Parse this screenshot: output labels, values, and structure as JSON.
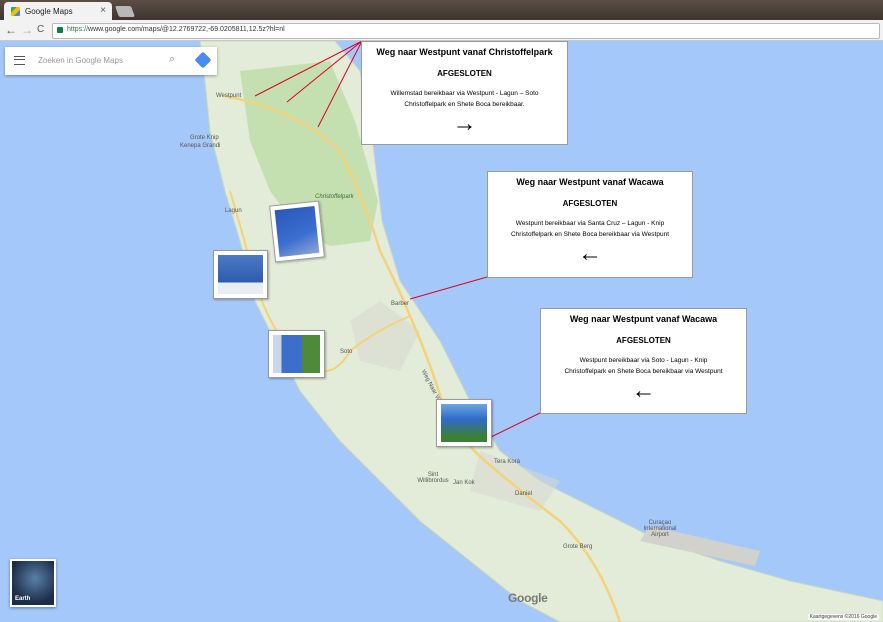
{
  "browser": {
    "tab_title": "Google Maps",
    "tab_close": "×",
    "back": "←",
    "forward": "→",
    "reload": "C",
    "url_scheme": "https://",
    "url_rest": "www.google.com/maps/@12.2769722,-69.0205811,12.5z?hl=nl"
  },
  "search": {
    "placeholder": "Zoeken in Google Maps",
    "search_icon": "search-icon",
    "directions_icon": "directions-icon"
  },
  "places": {
    "westpunt": "Westpunt",
    "grote_knip": "Grote Knip",
    "kenepa": "Kenepa Grandi",
    "christoffelpark": "Christoffelpark",
    "lagun": "Lagun",
    "barber": "Barber",
    "soto": "Soto",
    "weg_naar_westpunt": "Weg Naar Westpunt",
    "tera_kora": "Tera Korá",
    "sint_willibrordus": "Sint Willibrordus",
    "jan_kok": "Jan Kok",
    "daniel": "Daniel",
    "curacao_airport": "Curaçao International Airport",
    "grote_berg": "Grote Berg"
  },
  "callouts": [
    {
      "title": "Weg naar Westpunt vanaf Christoffelpark",
      "status": "AFGESLOTEN",
      "line1": "Willemstad bereikbaar  via Westpunt -  Lagun – Soto",
      "line2": "Christoffelpark en Shete Boca bereikbaar.",
      "arrow": "→"
    },
    {
      "title": "Weg naar Westpunt vanaf Wacawa",
      "status": "AFGESLOTEN",
      "line1": "Westpunt bereikbaar  via Santa Cruz – Lagun - Knip",
      "line2": "Christoffelpark en Shete Boca bereikbaar via Westpunt",
      "arrow": "←"
    },
    {
      "title": "Weg naar Westpunt vanaf Wacawa",
      "status": "AFGESLOTEN",
      "line1": "Westpunt bereikbaar  via Soto - Lagun - Knip",
      "line2": "Christoffelpark en Shete Boca bereikbaar via Westpunt",
      "arrow": "←"
    }
  ],
  "earth_label": "Earth",
  "google_logo": "Google",
  "attribution": "Kaartgegevens ©2016 Google",
  "colors": {
    "water": "#a5c8fa",
    "land": "#e3ecd8",
    "park": "#c5e0b0",
    "road": "#f4d27a",
    "pointer": "#e0001b"
  }
}
